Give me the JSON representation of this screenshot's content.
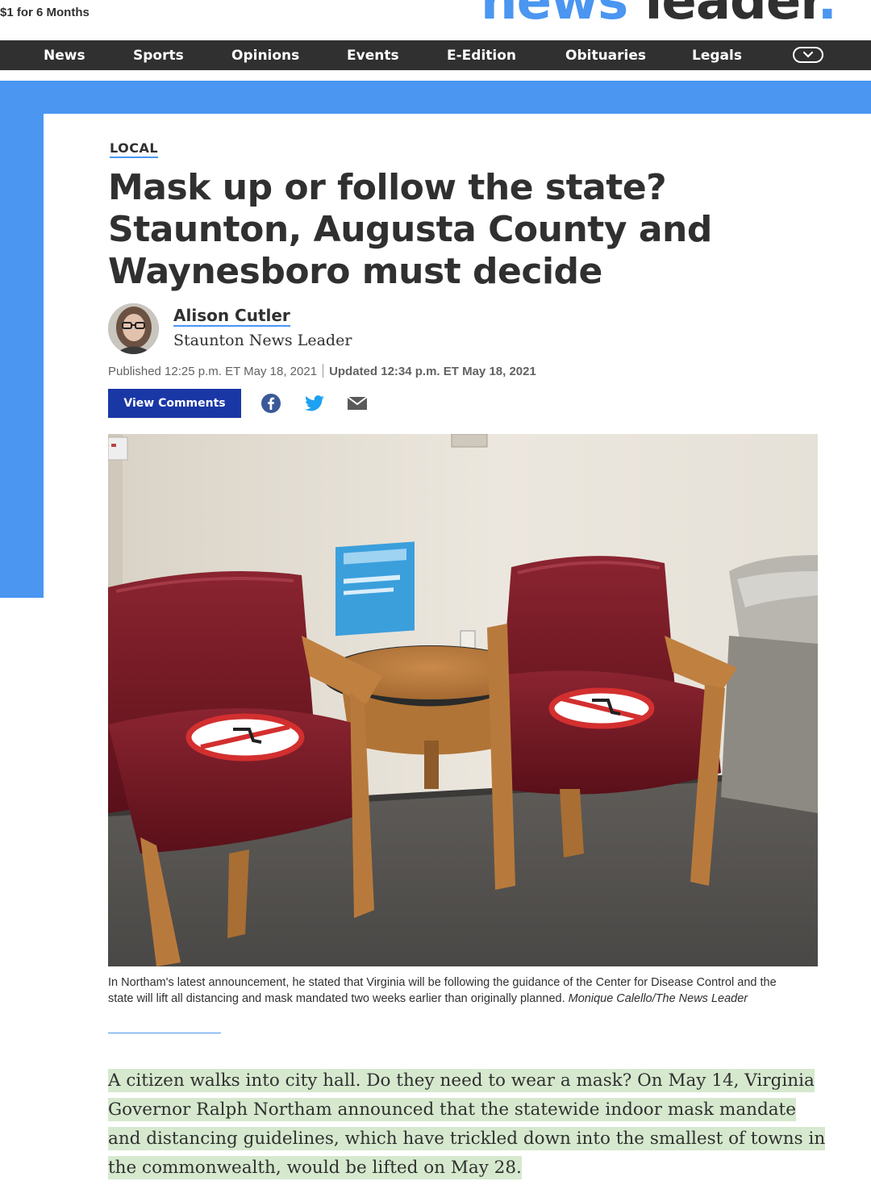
{
  "promo": {
    "text": "$1 for 6 Months"
  },
  "logo": {
    "word1": "news",
    "word2": "leader",
    "dot": "."
  },
  "nav": {
    "items": [
      "News",
      "Sports",
      "Opinions",
      "Events",
      "E-Edition",
      "Obituaries",
      "Legals"
    ],
    "more_icon": "chevron-down-icon"
  },
  "article": {
    "label": "LOCAL",
    "headline": "Mask up or follow the state? Staunton, Augusta County and Waynesboro must decide",
    "author": "Alison Cutler",
    "affiliation": "Staunton News Leader",
    "published": "Published 12:25 p.m. ET May 18, 2021",
    "updated": "Updated 12:34 p.m. ET May 18, 2021",
    "comments_button": "View Comments",
    "share_icons": [
      "facebook-icon",
      "twitter-icon",
      "email-icon"
    ],
    "image_caption": "In Northam's latest announcement, he stated that Virginia will be following the guidance of the Center for Disease Control and the state will lift all distancing and mask mandated two weeks earlier than originally planned.",
    "image_credit": "Monique Calello/The News Leader",
    "body": "A citizen walks into city hall. Do they need to wear a mask? On May 14, Virginia Governor Ralph Northam announced that the statewide indoor mask mandate and distancing guidelines, which have trickled down into the smallest of towns in the commonwealth, would be lifted on May 28."
  },
  "colors": {
    "brand_blue": "#4a96f0",
    "nav_bg": "#303030",
    "button_blue": "#1a37a6",
    "highlight": "#d6e9ce"
  }
}
